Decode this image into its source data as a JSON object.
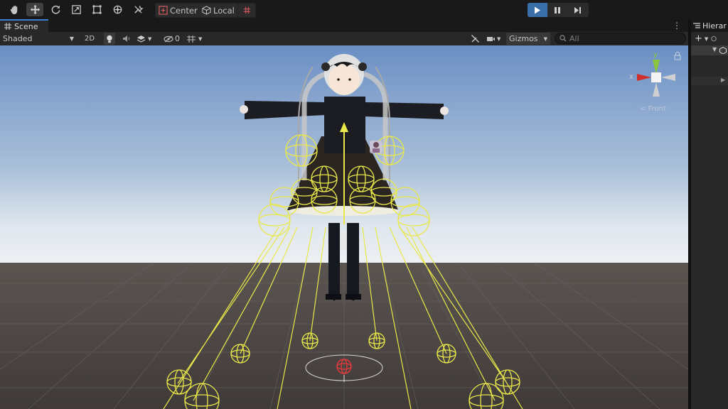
{
  "toolbar": {
    "tools": [
      "hand-tool",
      "move-tool",
      "rotate-tool",
      "scale-tool",
      "rect-tool",
      "transform-tool",
      "custom-tool"
    ],
    "active_tool": "move-tool",
    "pivot_label": "Center",
    "space_label": "Local"
  },
  "scene_tab": {
    "label": "Scene"
  },
  "scene_toolbar": {
    "draw_mode": "Shaded",
    "two_d": "2D",
    "hidden_count": "0",
    "gizmos": "Gizmos",
    "search_placeholder": "All"
  },
  "orientation": {
    "y_label": "y",
    "x_label": "x",
    "view_label": "Front"
  },
  "hierarchy": {
    "tab_label": "Hierar"
  },
  "colors": {
    "sky_top": "#6b8fc4",
    "horizon": "#dfe6ee",
    "ground": "#4a4441",
    "gizmo_yellow": "#e9e84a",
    "play_active": "#3a6ea8",
    "tab_accent": "#3d7fd6"
  }
}
